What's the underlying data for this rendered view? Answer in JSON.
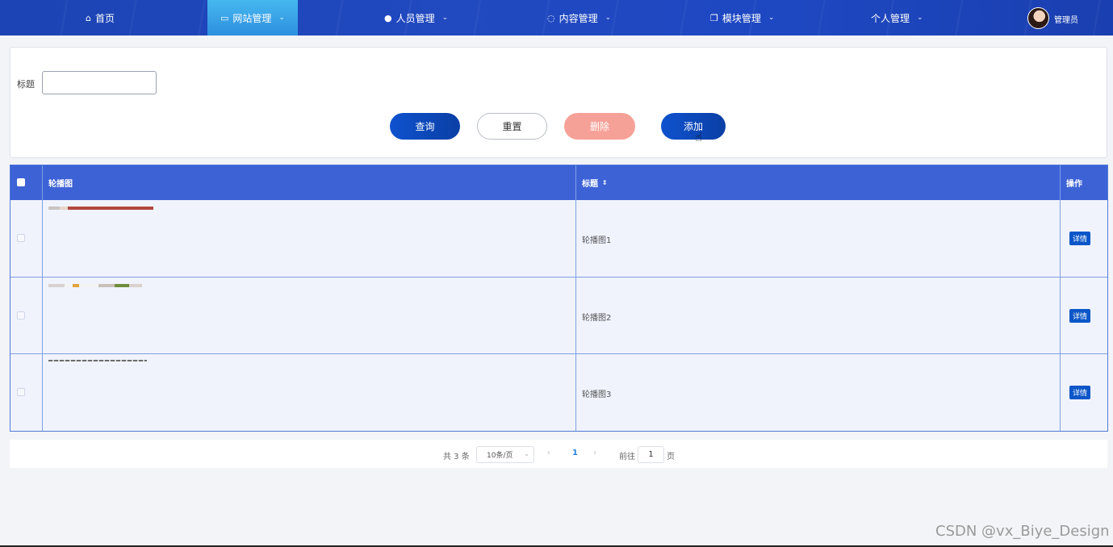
{
  "nav": {
    "home": "首页",
    "site_mgmt": "网站管理",
    "user_mgmt": "人员管理",
    "content_mgmt": "内容管理",
    "module_mgmt": "模块管理",
    "personal_mgmt": "个人管理",
    "admin_name": "管理员",
    "icons": {
      "home": "home-icon",
      "site": "monitor-icon",
      "user": "user-icon",
      "content": "chat-icon",
      "module": "copy-icon"
    }
  },
  "search": {
    "title_label": "标题",
    "title_value": "",
    "query": "查询",
    "reset": "重置",
    "delete": "删除",
    "add": "添加"
  },
  "table": {
    "headers": {
      "carousel": "轮播图",
      "title": "标题",
      "actions": "操作"
    },
    "rows": [
      {
        "title": "轮播图1",
        "detail": "详情"
      },
      {
        "title": "轮播图2",
        "detail": "详情"
      },
      {
        "title": "轮播图3",
        "detail": "详情"
      }
    ]
  },
  "pagination": {
    "total": "共 3 条",
    "page_size": "10条/页",
    "current_page": "1",
    "goto_label": "前往",
    "goto_value": "1",
    "page_suffix": "页"
  },
  "watermark": "CSDN @vx_Biye_Design",
  "colors": {
    "nav_bg": "#1c44b4",
    "nav_active": "#3aa6ea",
    "primary": "#0f52ce",
    "danger": "#f6a198",
    "table_header": "#3d62d6"
  }
}
